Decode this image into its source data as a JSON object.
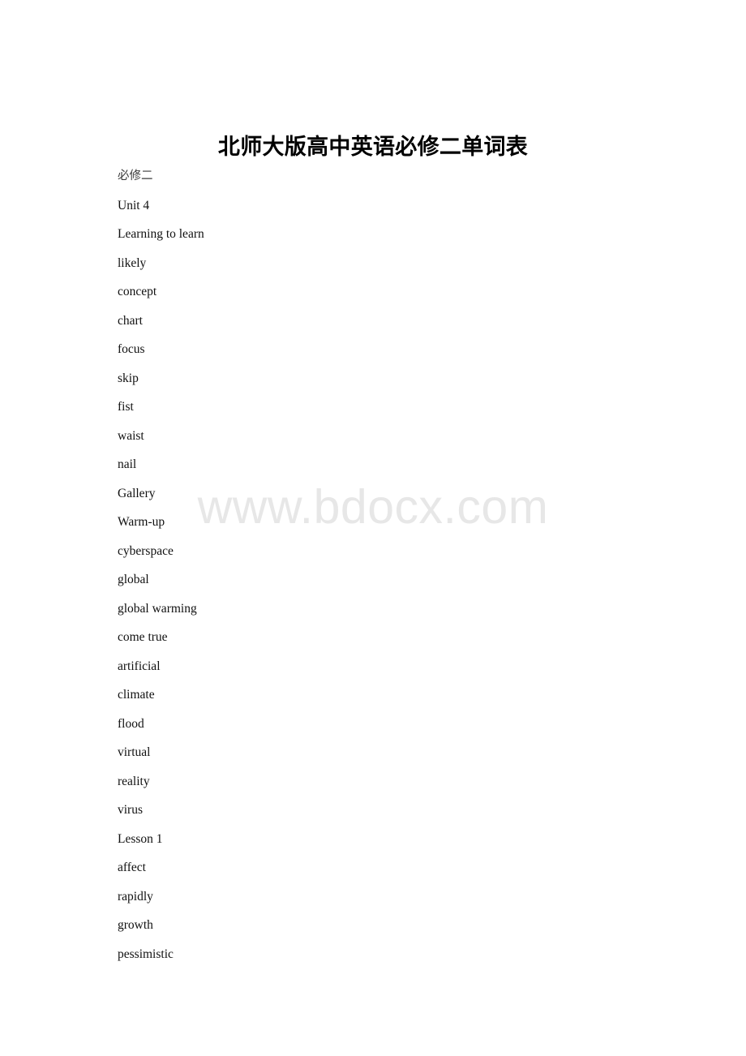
{
  "document": {
    "title": "北师大版高中英语必修二单词表",
    "watermark": "www.bdocx.com",
    "background_color": "#ffffff",
    "text_color": "#000000",
    "watermark_color": "#e7e7e7"
  },
  "body_lines": [
    {
      "text": "必修二",
      "script": "cjk"
    },
    {
      "text": "Unit 4",
      "script": "latin"
    },
    {
      "text": "Learning to learn",
      "script": "latin"
    },
    {
      "text": "likely",
      "script": "latin"
    },
    {
      "text": "concept",
      "script": "latin"
    },
    {
      "text": "chart",
      "script": "latin"
    },
    {
      "text": "focus",
      "script": "latin"
    },
    {
      "text": "skip",
      "script": "latin"
    },
    {
      "text": "fist",
      "script": "latin"
    },
    {
      "text": "waist",
      "script": "latin"
    },
    {
      "text": "nail",
      "script": "latin"
    },
    {
      "text": "Gallery",
      "script": "latin"
    },
    {
      "text": "Warm-up",
      "script": "latin"
    },
    {
      "text": "cyberspace",
      "script": "latin"
    },
    {
      "text": "global",
      "script": "latin"
    },
    {
      "text": "global warming",
      "script": "latin"
    },
    {
      "text": "come true",
      "script": "latin"
    },
    {
      "text": "artificial",
      "script": "latin"
    },
    {
      "text": "climate",
      "script": "latin"
    },
    {
      "text": "flood",
      "script": "latin"
    },
    {
      "text": "virtual",
      "script": "latin"
    },
    {
      "text": "reality",
      "script": "latin"
    },
    {
      "text": "virus",
      "script": "latin"
    },
    {
      "text": "Lesson 1",
      "script": "latin"
    },
    {
      "text": "affect",
      "script": "latin"
    },
    {
      "text": "rapidly",
      "script": "latin"
    },
    {
      "text": "growth",
      "script": "latin"
    },
    {
      "text": "pessimistic",
      "script": "latin"
    }
  ]
}
